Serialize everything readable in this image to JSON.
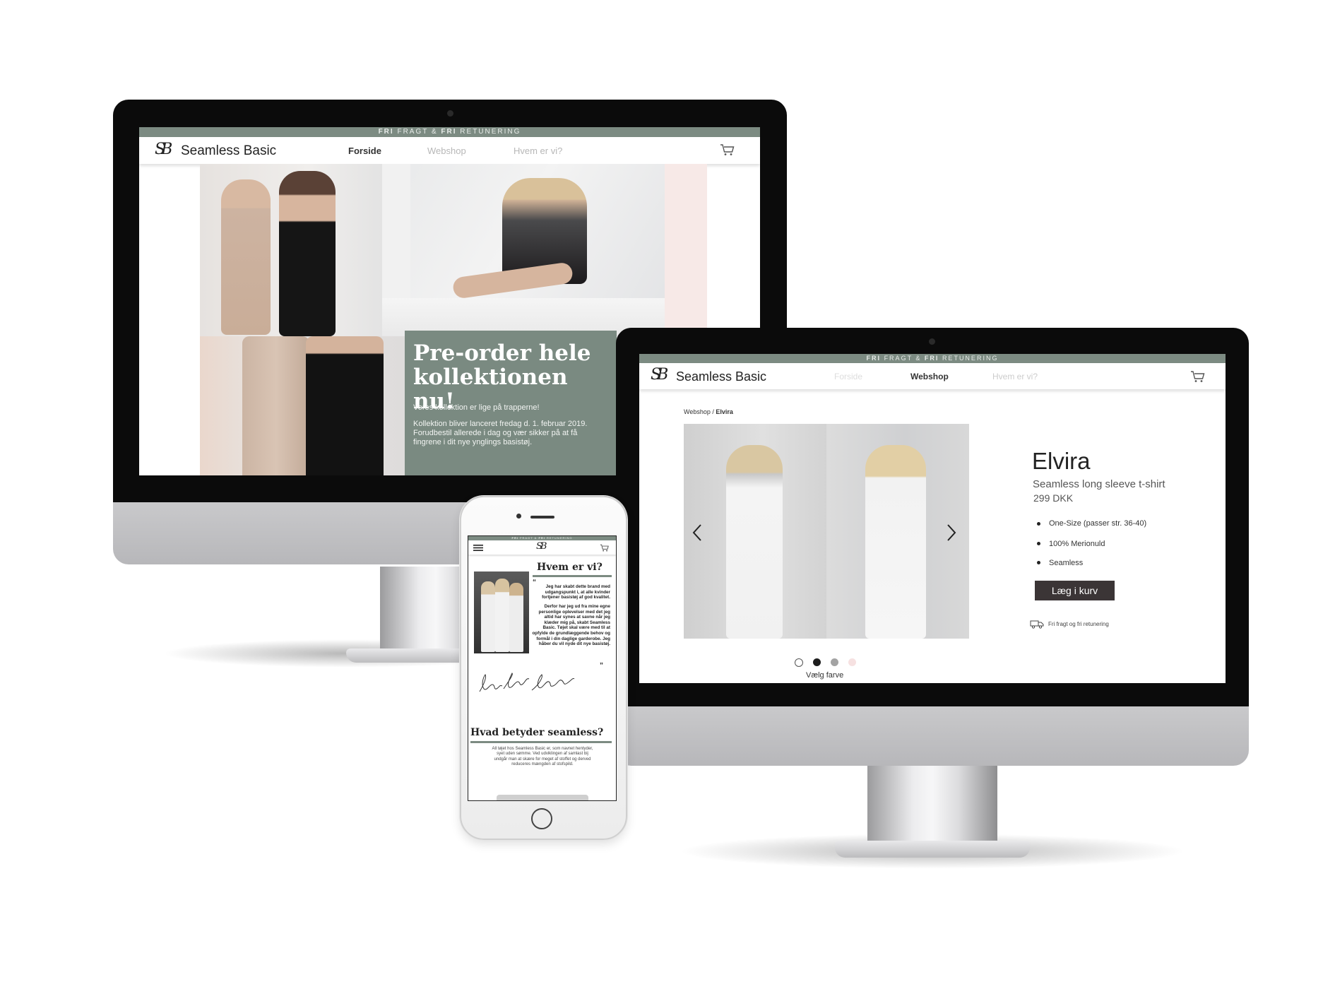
{
  "desktop_home": {
    "topbar": {
      "fri1": "FRI",
      "mid": "FRAGT &",
      "fri2": "FRI",
      "end": "RETUNERING"
    },
    "brand": "Seamless Basic",
    "logo": "SB",
    "nav": [
      "Forside",
      "Webshop",
      "Hvem er vi?"
    ],
    "promo": {
      "title": "Pre-order hele kollektionen nu!",
      "p1": "Vores kollektion er lige på trapperne!",
      "p2": "Kollektion bliver lanceret fredag d. 1. februar 2019. Forudbestil allerede i dag og vær sikker på at få fingrene i dit nye ynglings basistøj."
    }
  },
  "desktop_product": {
    "topbar": {
      "fri1": "FRI",
      "mid": "FRAGT &",
      "fri2": "FRI",
      "end": "RETUNERING"
    },
    "brand": "Seamless Basic",
    "logo": "SB",
    "nav": [
      "Forside",
      "Webshop",
      "Hvem er vi?"
    ],
    "breadcrumb": {
      "parent": "Webshop",
      "sep": " / ",
      "current": "Elvira"
    },
    "product": {
      "name": "Elvira",
      "subtitle": "Seamless long sleeve t-shirt",
      "price": "299 DKK",
      "features": [
        "One-Size (passer str. 36-40)",
        "100% Merionuld",
        "Seamless"
      ],
      "cta": "Læg i kurv",
      "shipping": "Fri fragt og fri retunering"
    },
    "gallery": {
      "prev_icon": "chevron-left-icon",
      "next_icon": "chevron-right-icon"
    },
    "colors": {
      "label": "Vælg farve",
      "swatches": [
        "#ffffff",
        "#1d1d1d",
        "#a3a3a3",
        "#f6e1e1"
      ]
    }
  },
  "mobile": {
    "topbar": {
      "fri1": "FRI",
      "mid": "FRAGT &",
      "fri2": "FRI",
      "end": "RETUNERING"
    },
    "logo": "SB",
    "section1_title": "Hvem er vi?",
    "quote_p1": "Jeg har skabt dette brand med udgangspunkt i, at alle kvinder fortjener basistøj af god kvalitet.",
    "quote_p2": "Derfor har jeg ud fra mine egne personlige oplevelser med det jeg altid har synes at savne når jeg klæder mig på, skabt Seamless Basic. Tøjet skal være med til at opfylde de grundlæggende behov og formål i din daglige garderobe. Jeg håber du vil nyde dit nye basistøj.",
    "section2_title": "Hvad betyder seamless?",
    "section2_text": "All tøjet hos Seamless Basic er, som navnet hentyder, syet uden sømme. Ved udviklingen af samlast bij undgår man at skære for meget af stoffet og derved reduceres mængden af stofspild."
  },
  "colors": {
    "brand_green": "#7a8a81",
    "button_dark": "#3b3536",
    "bezel": "#0b0b0b"
  }
}
